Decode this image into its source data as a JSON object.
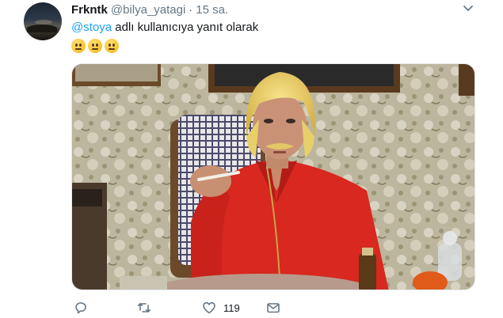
{
  "tweet": {
    "name": "Frkntk",
    "handle": "@bilya_yatagi",
    "separator": "·",
    "time": "15 sa.",
    "reply_mention": "@stoya",
    "reply_text": " adlı kullanıcıya yanıt olarak",
    "emojis": [
      "neutral-face",
      "neutral-face",
      "neutral-face"
    ]
  },
  "actions": {
    "reply_count": "",
    "retweet_count": "",
    "like_count": "119"
  },
  "colors": {
    "link": "#1da1f2",
    "secondary_text": "#657786",
    "icon": "#657786"
  }
}
